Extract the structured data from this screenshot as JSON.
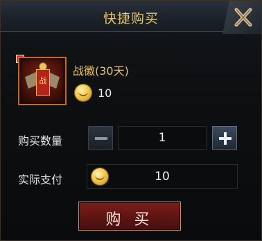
{
  "dialog": {
    "title": "快捷购买",
    "close_icon": "close-x-icon"
  },
  "item": {
    "name": "战徽(30天)",
    "icon": "war-emblem-icon",
    "glyph": "战",
    "price": "10",
    "price_currency_icon": "gold-coin-icon"
  },
  "quantity": {
    "label": "购买数量",
    "value": "1",
    "minus_icon": "minus-icon",
    "plus_icon": "plus-icon"
  },
  "payment": {
    "label": "实际支付",
    "value": "10",
    "currency_icon": "gold-coin-icon"
  },
  "buy_button": {
    "label": "购 买"
  },
  "colors": {
    "title_gold": "#e8c36a",
    "buy_red": "#5d1411",
    "panel_dark": "#0d0f11"
  }
}
